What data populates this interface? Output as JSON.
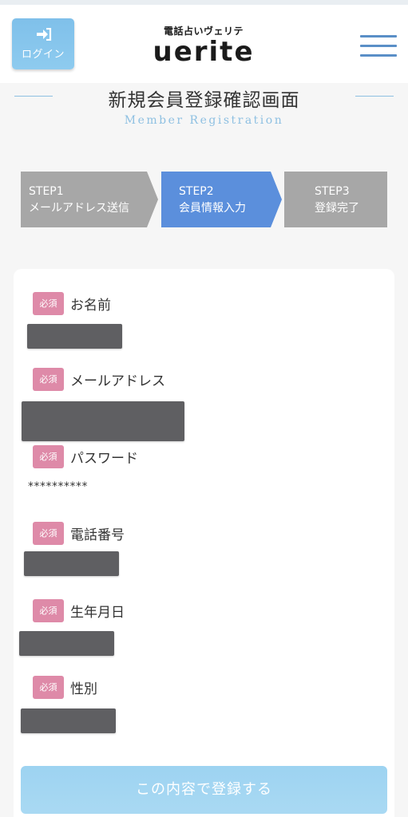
{
  "header": {
    "login_label": "ログイン",
    "logo_subtitle": "電話占いヴェリテ",
    "logo_main": "uerite"
  },
  "page": {
    "title": "新規会員登録確認画面",
    "subtitle": "Member Registration"
  },
  "steps": [
    {
      "num": "STEP1",
      "label": "メールアドレス送信",
      "active": false
    },
    {
      "num": "STEP2",
      "label": "会員情報入力",
      "active": true
    },
    {
      "num": "STEP3",
      "label": "登録完了",
      "active": false
    }
  ],
  "form": {
    "required_badge": "必須",
    "fields": [
      {
        "label": "お名前",
        "value_redacted": true
      },
      {
        "label": "メールアドレス",
        "value_redacted": true
      },
      {
        "label": "パスワード",
        "value": "**********"
      },
      {
        "label": "電話番号",
        "value_redacted": true
      },
      {
        "label": "生年月日",
        "value_redacted": true
      },
      {
        "label": "性別",
        "value_redacted": true
      }
    ],
    "submit_label": "この内容で登録する"
  },
  "colors": {
    "step_active": "#5b8fdc",
    "step_inactive": "#a7a7a7",
    "required_badge": "#de8aa8",
    "accent_blue": "#8ec0e2",
    "login_button": "#7fc0ea",
    "hamburger": "#5a8fc7"
  },
  "icons": {
    "login": "login-icon",
    "menu": "hamburger-menu-icon"
  }
}
